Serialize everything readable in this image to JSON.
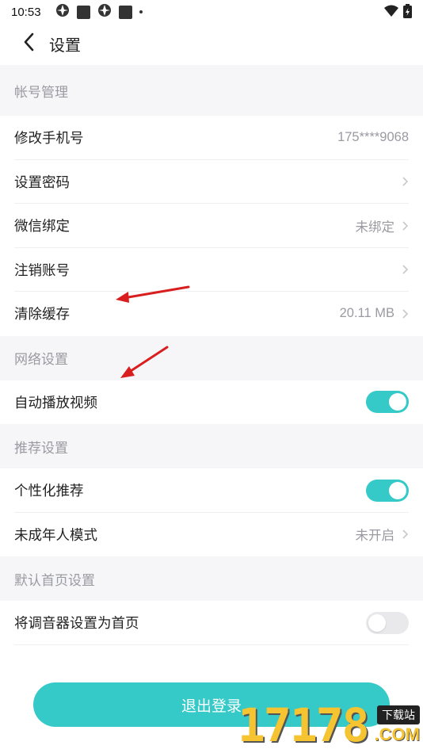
{
  "status_bar": {
    "time": "10:53",
    "icons": [
      "app-icon",
      "square-icon",
      "app-icon",
      "square-icon",
      "dot-icon"
    ],
    "right_icons": [
      "wifi-icon",
      "battery-icon"
    ]
  },
  "header": {
    "back_icon": "chevron-left-icon",
    "title": "设置"
  },
  "sections": [
    {
      "title": "帐号管理",
      "rows": [
        {
          "label": "修改手机号",
          "value": "175****9068",
          "chevron": false
        },
        {
          "label": "设置密码",
          "value": "",
          "chevron": true
        },
        {
          "label": "微信绑定",
          "value": "未绑定",
          "chevron": true
        },
        {
          "label": "注销账号",
          "value": "",
          "chevron": true
        },
        {
          "label": "清除缓存",
          "value": "20.11 MB",
          "chevron": true
        }
      ]
    },
    {
      "title": "网络设置",
      "rows": [
        {
          "label": "自动播放视频",
          "toggle": true
        }
      ]
    },
    {
      "title": "推荐设置",
      "rows": [
        {
          "label": "个性化推荐",
          "toggle": true
        },
        {
          "label": "未成年人模式",
          "value": "未开启",
          "chevron": true
        }
      ]
    },
    {
      "title": "默认首页设置",
      "rows": [
        {
          "label": "将调音器设置为首页",
          "toggle": false
        }
      ]
    }
  ],
  "logout_label": "退出登录",
  "watermark": {
    "number": "17178",
    "badge": "下载站",
    "suffix": ".COM"
  },
  "colors": {
    "accent": "#35c9c8",
    "section_bg": "#f6f6f8",
    "secondary_text": "#9a9aa2",
    "annotation_arrow": "#d81e1e"
  }
}
